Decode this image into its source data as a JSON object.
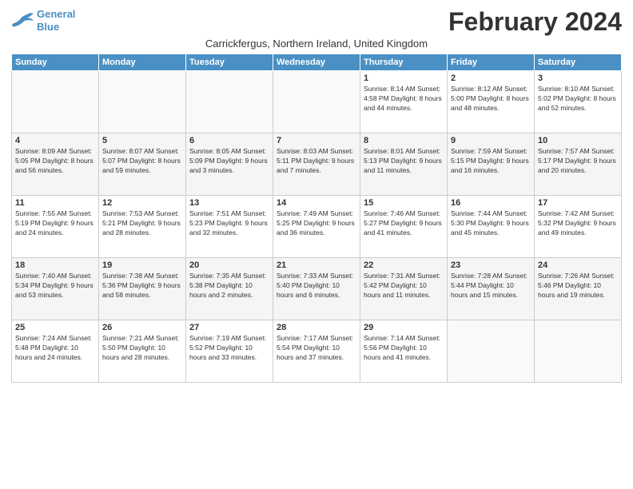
{
  "logo": {
    "line1": "General",
    "line2": "Blue"
  },
  "title": "February 2024",
  "subtitle": "Carrickfergus, Northern Ireland, United Kingdom",
  "days_of_week": [
    "Sunday",
    "Monday",
    "Tuesday",
    "Wednesday",
    "Thursday",
    "Friday",
    "Saturday"
  ],
  "weeks": [
    [
      {
        "day": "",
        "info": ""
      },
      {
        "day": "",
        "info": ""
      },
      {
        "day": "",
        "info": ""
      },
      {
        "day": "",
        "info": ""
      },
      {
        "day": "1",
        "info": "Sunrise: 8:14 AM\nSunset: 4:58 PM\nDaylight: 8 hours\nand 44 minutes."
      },
      {
        "day": "2",
        "info": "Sunrise: 8:12 AM\nSunset: 5:00 PM\nDaylight: 8 hours\nand 48 minutes."
      },
      {
        "day": "3",
        "info": "Sunrise: 8:10 AM\nSunset: 5:02 PM\nDaylight: 8 hours\nand 52 minutes."
      }
    ],
    [
      {
        "day": "4",
        "info": "Sunrise: 8:09 AM\nSunset: 5:05 PM\nDaylight: 8 hours\nand 56 minutes."
      },
      {
        "day": "5",
        "info": "Sunrise: 8:07 AM\nSunset: 5:07 PM\nDaylight: 8 hours\nand 59 minutes."
      },
      {
        "day": "6",
        "info": "Sunrise: 8:05 AM\nSunset: 5:09 PM\nDaylight: 9 hours\nand 3 minutes."
      },
      {
        "day": "7",
        "info": "Sunrise: 8:03 AM\nSunset: 5:11 PM\nDaylight: 9 hours\nand 7 minutes."
      },
      {
        "day": "8",
        "info": "Sunrise: 8:01 AM\nSunset: 5:13 PM\nDaylight: 9 hours\nand 11 minutes."
      },
      {
        "day": "9",
        "info": "Sunrise: 7:59 AM\nSunset: 5:15 PM\nDaylight: 9 hours\nand 16 minutes."
      },
      {
        "day": "10",
        "info": "Sunrise: 7:57 AM\nSunset: 5:17 PM\nDaylight: 9 hours\nand 20 minutes."
      }
    ],
    [
      {
        "day": "11",
        "info": "Sunrise: 7:55 AM\nSunset: 5:19 PM\nDaylight: 9 hours\nand 24 minutes."
      },
      {
        "day": "12",
        "info": "Sunrise: 7:53 AM\nSunset: 5:21 PM\nDaylight: 9 hours\nand 28 minutes."
      },
      {
        "day": "13",
        "info": "Sunrise: 7:51 AM\nSunset: 5:23 PM\nDaylight: 9 hours\nand 32 minutes."
      },
      {
        "day": "14",
        "info": "Sunrise: 7:49 AM\nSunset: 5:25 PM\nDaylight: 9 hours\nand 36 minutes."
      },
      {
        "day": "15",
        "info": "Sunrise: 7:46 AM\nSunset: 5:27 PM\nDaylight: 9 hours\nand 41 minutes."
      },
      {
        "day": "16",
        "info": "Sunrise: 7:44 AM\nSunset: 5:30 PM\nDaylight: 9 hours\nand 45 minutes."
      },
      {
        "day": "17",
        "info": "Sunrise: 7:42 AM\nSunset: 5:32 PM\nDaylight: 9 hours\nand 49 minutes."
      }
    ],
    [
      {
        "day": "18",
        "info": "Sunrise: 7:40 AM\nSunset: 5:34 PM\nDaylight: 9 hours\nand 53 minutes."
      },
      {
        "day": "19",
        "info": "Sunrise: 7:38 AM\nSunset: 5:36 PM\nDaylight: 9 hours\nand 58 minutes."
      },
      {
        "day": "20",
        "info": "Sunrise: 7:35 AM\nSunset: 5:38 PM\nDaylight: 10 hours\nand 2 minutes."
      },
      {
        "day": "21",
        "info": "Sunrise: 7:33 AM\nSunset: 5:40 PM\nDaylight: 10 hours\nand 6 minutes."
      },
      {
        "day": "22",
        "info": "Sunrise: 7:31 AM\nSunset: 5:42 PM\nDaylight: 10 hours\nand 11 minutes."
      },
      {
        "day": "23",
        "info": "Sunrise: 7:28 AM\nSunset: 5:44 PM\nDaylight: 10 hours\nand 15 minutes."
      },
      {
        "day": "24",
        "info": "Sunrise: 7:26 AM\nSunset: 5:46 PM\nDaylight: 10 hours\nand 19 minutes."
      }
    ],
    [
      {
        "day": "25",
        "info": "Sunrise: 7:24 AM\nSunset: 5:48 PM\nDaylight: 10 hours\nand 24 minutes."
      },
      {
        "day": "26",
        "info": "Sunrise: 7:21 AM\nSunset: 5:50 PM\nDaylight: 10 hours\nand 28 minutes."
      },
      {
        "day": "27",
        "info": "Sunrise: 7:19 AM\nSunset: 5:52 PM\nDaylight: 10 hours\nand 33 minutes."
      },
      {
        "day": "28",
        "info": "Sunrise: 7:17 AM\nSunset: 5:54 PM\nDaylight: 10 hours\nand 37 minutes."
      },
      {
        "day": "29",
        "info": "Sunrise: 7:14 AM\nSunset: 5:56 PM\nDaylight: 10 hours\nand 41 minutes."
      },
      {
        "day": "",
        "info": ""
      },
      {
        "day": "",
        "info": ""
      }
    ]
  ]
}
